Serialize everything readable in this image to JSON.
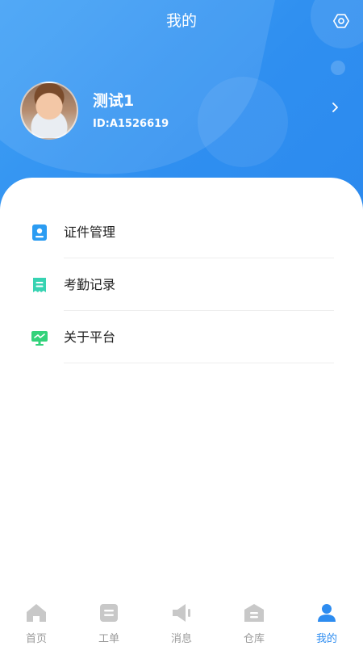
{
  "header": {
    "title": "我的"
  },
  "profile": {
    "name": "测试1",
    "id_text": "ID:A1526619"
  },
  "menu": {
    "items": [
      {
        "label": "证件管理",
        "icon": "id-card-icon"
      },
      {
        "label": "考勤记录",
        "icon": "attendance-record-icon"
      },
      {
        "label": "关于平台",
        "icon": "platform-monitor-icon"
      }
    ]
  },
  "tabbar": {
    "items": [
      {
        "label": "首页",
        "icon": "home-icon"
      },
      {
        "label": "工单",
        "icon": "work-order-icon"
      },
      {
        "label": "消息",
        "icon": "message-speaker-icon"
      },
      {
        "label": "仓库",
        "icon": "warehouse-icon"
      },
      {
        "label": "我的",
        "icon": "user-icon"
      }
    ],
    "active": "我的"
  },
  "colors": {
    "primary": "#2d8cf0",
    "header_gradient_start": "#3fa0f5",
    "header_gradient_end": "#2b89ee",
    "tab_inactive": "#9a9a9a",
    "id_icon_blue": "#2b9cf2",
    "attendance_icon_teal": "#37d3b2",
    "platform_icon_green": "#32d27a"
  }
}
